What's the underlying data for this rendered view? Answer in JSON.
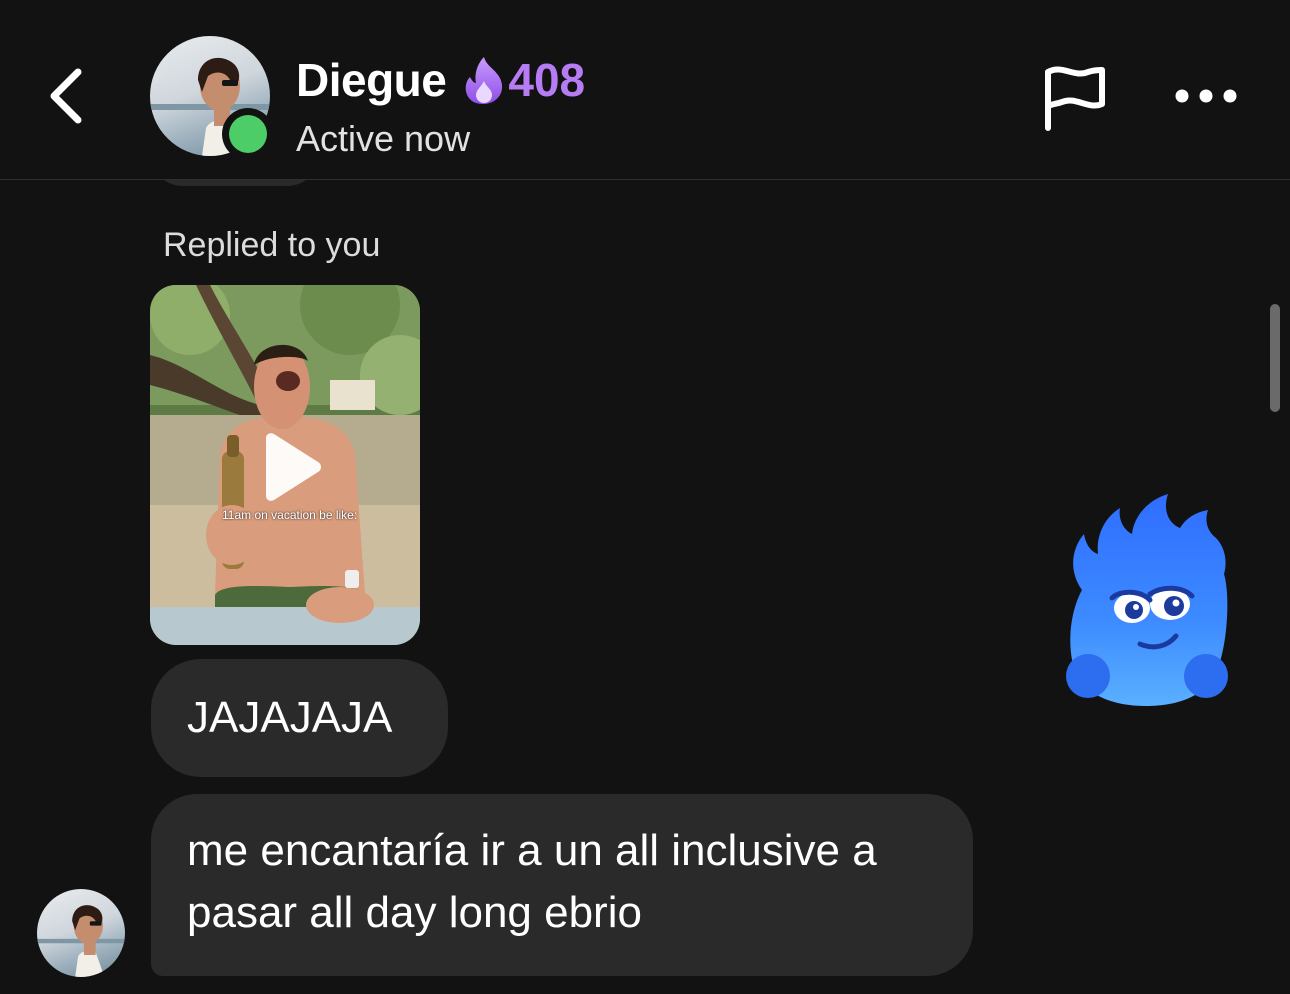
{
  "header": {
    "contact_name": "Diegue",
    "streak_count": "408",
    "status": "Active now",
    "streak_color": "#b57cf4",
    "online_color": "#4ccd67",
    "icons": [
      "back-chevron-icon",
      "streak-flame-icon",
      "report-flag-icon",
      "more-dots-icon"
    ]
  },
  "thread": {
    "reply_label": "Replied to you",
    "video": {
      "caption": "11am on vacation be like:",
      "icon": "play-icon"
    },
    "messages": [
      {
        "text": "JAJAJAJA"
      },
      {
        "text": "me encantaría ir a un all inclusive a\npasar all day long ebrio"
      }
    ],
    "sticker": "blue-flame-sticker"
  },
  "colors": {
    "background": "#121212",
    "bubble": "#2a2a2a"
  }
}
